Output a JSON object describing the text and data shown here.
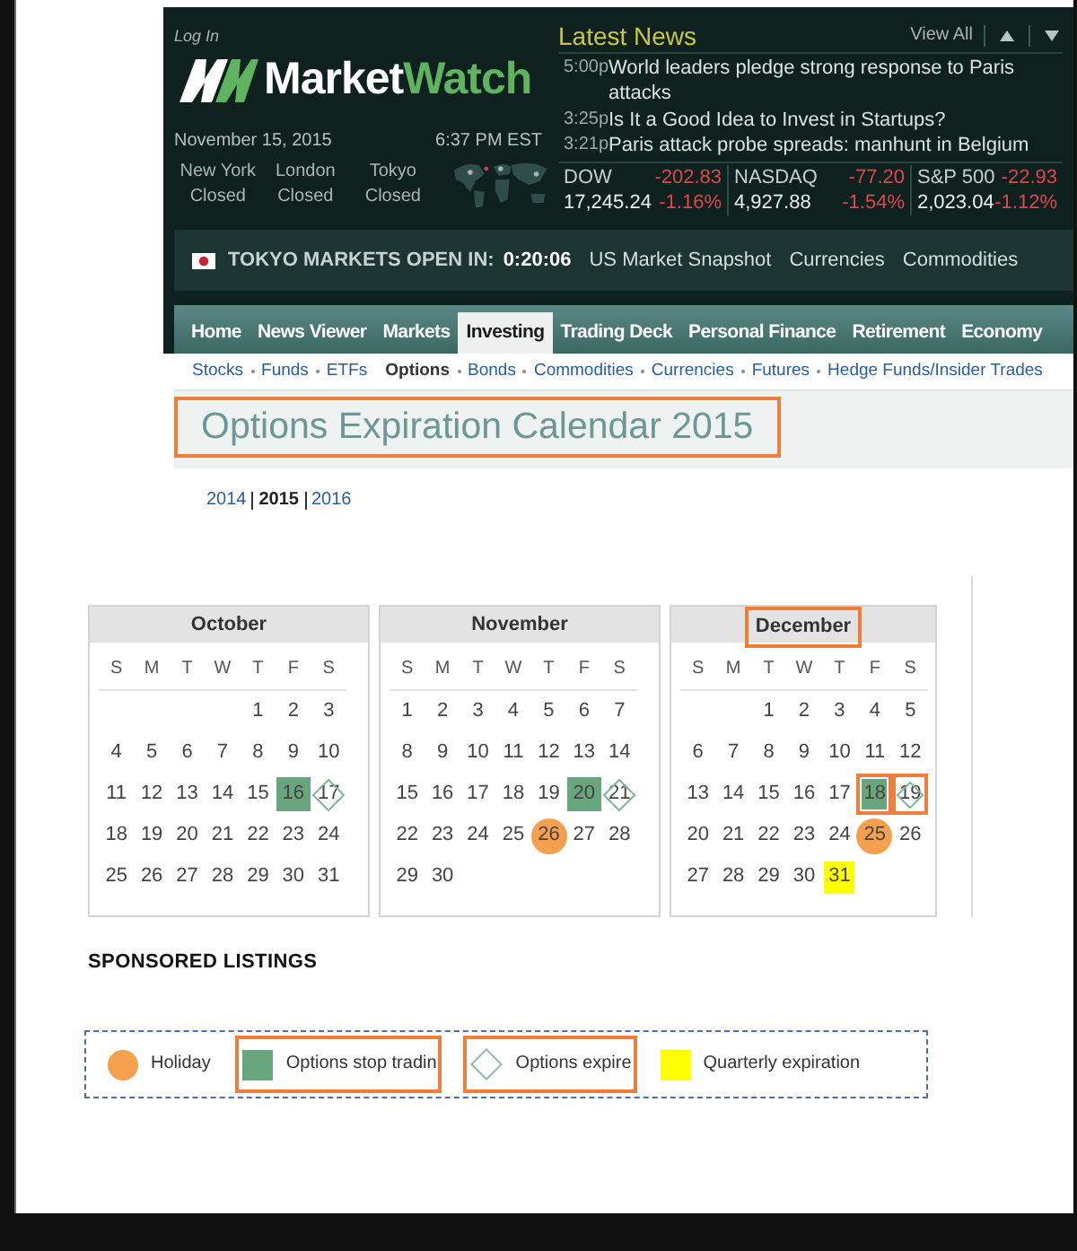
{
  "header": {
    "login": "Log In",
    "logo": {
      "primary": "Market",
      "accent": "Watch"
    },
    "date": "November 15, 2015",
    "time": "6:37 PM EST",
    "markets": [
      {
        "city": "New York",
        "status": "Closed"
      },
      {
        "city": "London",
        "status": "Closed"
      },
      {
        "city": "Tokyo",
        "status": "Closed"
      }
    ]
  },
  "latest_news": {
    "title": "Latest News",
    "view_all": "View All",
    "items": [
      {
        "time": "5:00p",
        "headline": "World leaders pledge strong response to Paris attacks"
      },
      {
        "time": "3:25p",
        "headline": "Is It a Good Idea to Invest in Startups?"
      },
      {
        "time": "3:21p",
        "headline": "Paris attack probe spreads: manhunt in Belgium"
      }
    ]
  },
  "indices": [
    {
      "name": "DOW",
      "change": "-202.83",
      "value": "17,245.24",
      "percent": "-1.16%",
      "down": true
    },
    {
      "name": "NASDAQ",
      "change": "-77.20",
      "value": "4,927.88",
      "percent": "-1.54%",
      "down": true
    },
    {
      "name": "S&P 500",
      "change": "-22.93",
      "value": "2,023.04",
      "percent": "-1.12%",
      "down": true
    }
  ],
  "ticker_bar": {
    "label": "TOKYO MARKETS OPEN IN:",
    "countdown": "0:20:06",
    "links": [
      "US Market Snapshot",
      "Currencies",
      "Commodities"
    ]
  },
  "nav": [
    {
      "label": "Home",
      "selected": false
    },
    {
      "label": "News Viewer",
      "selected": false
    },
    {
      "label": "Markets",
      "selected": false
    },
    {
      "label": "Investing",
      "selected": true
    },
    {
      "label": "Trading Deck",
      "selected": false
    },
    {
      "label": "Personal Finance",
      "selected": false
    },
    {
      "label": "Retirement",
      "selected": false
    },
    {
      "label": "Economy",
      "selected": false
    }
  ],
  "subnav": [
    {
      "label": "Stocks",
      "selected": false
    },
    {
      "label": "Funds",
      "selected": false
    },
    {
      "label": "ETFs",
      "selected": false
    },
    {
      "label": "Options",
      "selected": true
    },
    {
      "label": "Bonds",
      "selected": false
    },
    {
      "label": "Commodities",
      "selected": false
    },
    {
      "label": "Currencies",
      "selected": false
    },
    {
      "label": "Futures",
      "selected": false
    },
    {
      "label": "Hedge Funds/Insider Trades",
      "selected": false
    }
  ],
  "title": {
    "text": "Options Expiration Calendar 2015",
    "highlighted": true
  },
  "years": [
    {
      "label": "2014",
      "selected": false
    },
    {
      "label": "2015",
      "selected": true
    },
    {
      "label": "2016",
      "selected": false
    }
  ],
  "calendars": [
    {
      "month": "October",
      "highlighted": false,
      "weekdays": [
        "S",
        "M",
        "T",
        "W",
        "T",
        "F",
        "S"
      ],
      "weeks": [
        [
          {
            "kind": "blank",
            "highlighted": false
          },
          {
            "kind": "blank",
            "highlighted": false
          },
          {
            "kind": "blank",
            "highlighted": false
          },
          {
            "kind": "blank",
            "highlighted": false
          },
          {
            "day": "1",
            "kind": "day",
            "highlighted": false
          },
          {
            "day": "2",
            "kind": "day",
            "highlighted": false
          },
          {
            "day": "3",
            "kind": "day",
            "highlighted": false
          }
        ],
        [
          {
            "day": "4",
            "kind": "day",
            "highlighted": false
          },
          {
            "day": "5",
            "kind": "day",
            "highlighted": false
          },
          {
            "day": "6",
            "kind": "day",
            "highlighted": false
          },
          {
            "day": "7",
            "kind": "day",
            "highlighted": false
          },
          {
            "day": "8",
            "kind": "day",
            "highlighted": false
          },
          {
            "day": "9",
            "kind": "day",
            "highlighted": false
          },
          {
            "day": "10",
            "kind": "day",
            "highlighted": false
          }
        ],
        [
          {
            "day": "11",
            "kind": "day",
            "highlighted": false
          },
          {
            "day": "12",
            "kind": "day",
            "highlighted": false
          },
          {
            "day": "13",
            "kind": "day",
            "highlighted": false
          },
          {
            "day": "14",
            "kind": "day",
            "highlighted": false
          },
          {
            "day": "15",
            "kind": "day",
            "highlighted": false
          },
          {
            "day": "16",
            "kind": "stop_trading",
            "highlighted": false
          },
          {
            "day": "17",
            "kind": "expire",
            "highlighted": false
          }
        ],
        [
          {
            "day": "18",
            "kind": "day",
            "highlighted": false
          },
          {
            "day": "19",
            "kind": "day",
            "highlighted": false
          },
          {
            "day": "20",
            "kind": "day",
            "highlighted": false
          },
          {
            "day": "21",
            "kind": "day",
            "highlighted": false
          },
          {
            "day": "22",
            "kind": "day",
            "highlighted": false
          },
          {
            "day": "23",
            "kind": "day",
            "highlighted": false
          },
          {
            "day": "24",
            "kind": "day",
            "highlighted": false
          }
        ],
        [
          {
            "day": "25",
            "kind": "day",
            "highlighted": false
          },
          {
            "day": "26",
            "kind": "day",
            "highlighted": false
          },
          {
            "day": "27",
            "kind": "day",
            "highlighted": false
          },
          {
            "day": "28",
            "kind": "day",
            "highlighted": false
          },
          {
            "day": "29",
            "kind": "day",
            "highlighted": false
          },
          {
            "day": "30",
            "kind": "day",
            "highlighted": false
          },
          {
            "day": "31",
            "kind": "day",
            "highlighted": false
          }
        ]
      ]
    },
    {
      "month": "November",
      "highlighted": false,
      "weekdays": [
        "S",
        "M",
        "T",
        "W",
        "T",
        "F",
        "S"
      ],
      "weeks": [
        [
          {
            "day": "1",
            "kind": "day",
            "highlighted": false
          },
          {
            "day": "2",
            "kind": "day",
            "highlighted": false
          },
          {
            "day": "3",
            "kind": "day",
            "highlighted": false
          },
          {
            "day": "4",
            "kind": "day",
            "highlighted": false
          },
          {
            "day": "5",
            "kind": "day",
            "highlighted": false
          },
          {
            "day": "6",
            "kind": "day",
            "highlighted": false
          },
          {
            "day": "7",
            "kind": "day",
            "highlighted": false
          }
        ],
        [
          {
            "day": "8",
            "kind": "day",
            "highlighted": false
          },
          {
            "day": "9",
            "kind": "day",
            "highlighted": false
          },
          {
            "day": "10",
            "kind": "day",
            "highlighted": false
          },
          {
            "day": "11",
            "kind": "day",
            "highlighted": false
          },
          {
            "day": "12",
            "kind": "day",
            "highlighted": false
          },
          {
            "day": "13",
            "kind": "day",
            "highlighted": false
          },
          {
            "day": "14",
            "kind": "day",
            "highlighted": false
          }
        ],
        [
          {
            "day": "15",
            "kind": "day",
            "highlighted": false
          },
          {
            "day": "16",
            "kind": "day",
            "highlighted": false
          },
          {
            "day": "17",
            "kind": "day",
            "highlighted": false
          },
          {
            "day": "18",
            "kind": "day",
            "highlighted": false
          },
          {
            "day": "19",
            "kind": "day",
            "highlighted": false
          },
          {
            "day": "20",
            "kind": "stop_trading",
            "highlighted": false
          },
          {
            "day": "21",
            "kind": "expire",
            "highlighted": false
          }
        ],
        [
          {
            "day": "22",
            "kind": "day",
            "highlighted": false
          },
          {
            "day": "23",
            "kind": "day",
            "highlighted": false
          },
          {
            "day": "24",
            "kind": "day",
            "highlighted": false
          },
          {
            "day": "25",
            "kind": "day",
            "highlighted": false
          },
          {
            "day": "26",
            "kind": "holiday",
            "highlighted": false
          },
          {
            "day": "27",
            "kind": "day",
            "highlighted": false
          },
          {
            "day": "28",
            "kind": "day",
            "highlighted": false
          }
        ],
        [
          {
            "day": "29",
            "kind": "day",
            "highlighted": false
          },
          {
            "day": "30",
            "kind": "day",
            "highlighted": false
          }
        ]
      ]
    },
    {
      "month": "December",
      "highlighted": true,
      "weekdays": [
        "S",
        "M",
        "T",
        "W",
        "T",
        "F",
        "S"
      ],
      "weeks": [
        [
          {
            "kind": "blank",
            "highlighted": false
          },
          {
            "kind": "blank",
            "highlighted": false
          },
          {
            "day": "1",
            "kind": "day",
            "highlighted": false
          },
          {
            "day": "2",
            "kind": "day",
            "highlighted": false
          },
          {
            "day": "3",
            "kind": "day",
            "highlighted": false
          },
          {
            "day": "4",
            "kind": "day",
            "highlighted": false
          },
          {
            "day": "5",
            "kind": "day",
            "highlighted": false
          }
        ],
        [
          {
            "day": "6",
            "kind": "day",
            "highlighted": false
          },
          {
            "day": "7",
            "kind": "day",
            "highlighted": false
          },
          {
            "day": "8",
            "kind": "day",
            "highlighted": false
          },
          {
            "day": "9",
            "kind": "day",
            "highlighted": false
          },
          {
            "day": "10",
            "kind": "day",
            "highlighted": false
          },
          {
            "day": "11",
            "kind": "day",
            "highlighted": false
          },
          {
            "day": "12",
            "kind": "day",
            "highlighted": false
          }
        ],
        [
          {
            "day": "13",
            "kind": "day",
            "highlighted": false
          },
          {
            "day": "14",
            "kind": "day",
            "highlighted": false
          },
          {
            "day": "15",
            "kind": "day",
            "highlighted": false
          },
          {
            "day": "16",
            "kind": "day",
            "highlighted": false
          },
          {
            "day": "17",
            "kind": "day",
            "highlighted": false
          },
          {
            "day": "18",
            "kind": "stop_trading",
            "highlighted": true
          },
          {
            "day": "19",
            "kind": "expire",
            "highlighted": true
          }
        ],
        [
          {
            "day": "20",
            "kind": "day",
            "highlighted": false
          },
          {
            "day": "21",
            "kind": "day",
            "highlighted": false
          },
          {
            "day": "22",
            "kind": "day",
            "highlighted": false
          },
          {
            "day": "23",
            "kind": "day",
            "highlighted": false
          },
          {
            "day": "24",
            "kind": "day",
            "highlighted": false
          },
          {
            "day": "25",
            "kind": "holiday",
            "highlighted": false
          },
          {
            "day": "26",
            "kind": "day",
            "highlighted": false
          }
        ],
        [
          {
            "day": "27",
            "kind": "day",
            "highlighted": false
          },
          {
            "day": "28",
            "kind": "day",
            "highlighted": false
          },
          {
            "day": "29",
            "kind": "day",
            "highlighted": false
          },
          {
            "day": "30",
            "kind": "day",
            "highlighted": false
          },
          {
            "day": "31",
            "kind": "quarterly",
            "highlighted": false
          }
        ]
      ]
    }
  ],
  "sponsored_heading": "SPONSORED LISTINGS",
  "legend": [
    {
      "kind": "holiday",
      "label": "Holiday",
      "highlighted": false
    },
    {
      "kind": "stop_trading",
      "label": "Options stop tradin",
      "highlighted": true
    },
    {
      "kind": "expire",
      "label": "Options expire",
      "highlighted": true
    },
    {
      "kind": "quarterly",
      "label": "Quarterly expiration",
      "highlighted": false
    }
  ]
}
